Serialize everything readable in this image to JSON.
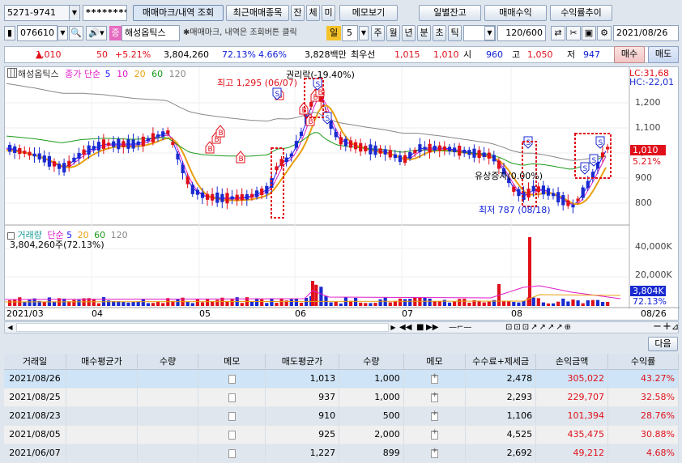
{
  "topbar": {
    "account": "5271-9741",
    "password": "********",
    "tab_memo_mark": "매매마크/내역 조회",
    "tab_recent": "최근매매종목",
    "small_btns": [
      "잔",
      "체",
      "미"
    ],
    "memo_view": "메모보기",
    "daily_balance": "일별잔고",
    "trade_profit": "매매수익",
    "return_trend": "수익률추이"
  },
  "toolbar": {
    "code": "076610",
    "badge": "증",
    "stock_name": "해성옵틱스",
    "hint": "✱매매마크, 내역은 조회버튼 클릭",
    "period_label": "일",
    "period_value": "5",
    "periods": [
      "주",
      "월",
      "년",
      "분",
      "초",
      "틱"
    ],
    "count": "120",
    "count_total": "/600",
    "date": "2021/08/26"
  },
  "quote": {
    "price": "1,010",
    "change": "50",
    "change_pct": "+5.21%",
    "volume": "3,804,260",
    "vol_ratio": "72.13%",
    "turnover": "4.66%",
    "amount": "3,828백만",
    "pref_label": "최우선",
    "best_ask": "1,015",
    "best_bid": "1,010",
    "open_label": "시",
    "open": "960",
    "high_label": "고",
    "high": "1,050",
    "low_label": "저",
    "low": "947",
    "buy": "매수",
    "sell": "매도"
  },
  "chart": {
    "legend_name": "해성옵틱스",
    "legend_price": "종가 단순",
    "ma": [
      {
        "label": "5",
        "color": "#1a1aff"
      },
      {
        "label": "10",
        "color": "#e01ac8"
      },
      {
        "label": "20",
        "color": "#e8a010"
      },
      {
        "label": "60",
        "color": "#1a9a1a"
      },
      {
        "label": "120",
        "color": "#888888"
      }
    ],
    "lc": "LC:31,68",
    "hc": "HC:-22,01",
    "y_ticks": [
      "1,200",
      "1,100",
      "1,000",
      "900",
      "800"
    ],
    "price_tag": "1,010",
    "price_tag_pct": "5.21%",
    "ann_high": "최고 1,295 (06/07)",
    "ann_drop": "권리락(-19.40%)",
    "ann_rights": "유상증자(0.00%)",
    "ann_low": "최저 787 (08/18)",
    "buy_mark": "B",
    "sell_mark": "S",
    "vol_legend_name": "거래량",
    "vol_legend_type": "단순",
    "vol_ma": [
      {
        "label": "5",
        "color": "#1a1aff"
      },
      {
        "label": "20",
        "color": "#e8a010"
      },
      {
        "label": "60",
        "color": "#1a9a1a"
      },
      {
        "label": "120",
        "color": "#888888"
      }
    ],
    "vol_value": "3,804,260주(72.13%)",
    "vol_ticks": [
      "40,000K",
      "20,000K"
    ],
    "vol_tag": "3,804K",
    "vol_tag_pct": "72.13%",
    "x_ticks": [
      "2021/03",
      "04",
      "05",
      "06",
      "07",
      "08"
    ],
    "x_last": "08/26",
    "accent_up": "#e0101a",
    "accent_down": "#1a2ad0"
  },
  "nav": {
    "next": "다음"
  },
  "table": {
    "headers": [
      "거래일",
      "매수평균가",
      "수량",
      "메모",
      "매도평균가",
      "수량",
      "메모",
      "수수료+제세금",
      "손익금액",
      "수익률"
    ],
    "rows": [
      [
        "2021/08/26",
        "",
        "",
        "",
        "1,013",
        "1,000",
        "",
        "2,478",
        "305,022",
        "43.27%"
      ],
      [
        "2021/08/25",
        "",
        "",
        "",
        "937",
        "1,000",
        "",
        "2,293",
        "229,707",
        "32.58%"
      ],
      [
        "2021/08/23",
        "",
        "",
        "",
        "910",
        "500",
        "",
        "1,106",
        "101,394",
        "28.76%"
      ],
      [
        "2021/08/05",
        "",
        "",
        "",
        "925",
        "2,000",
        "",
        "4,525",
        "435,475",
        "30.88%"
      ],
      [
        "2021/06/07",
        "",
        "",
        "",
        "1,227",
        "899",
        "",
        "2,692",
        "49,212",
        "4.68%"
      ]
    ]
  }
}
